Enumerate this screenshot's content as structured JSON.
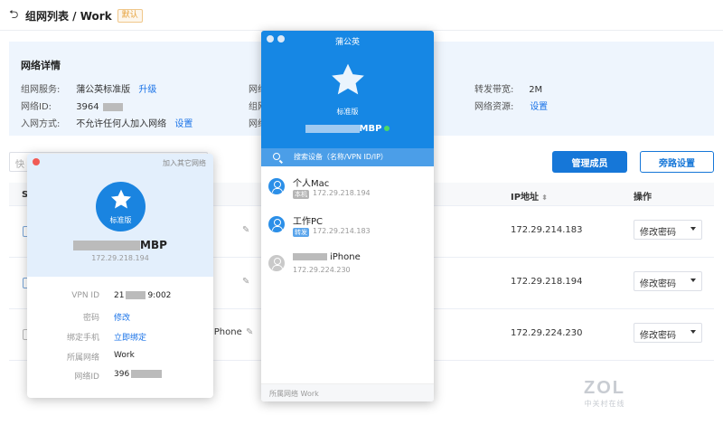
{
  "header": {
    "title": "组网列表 / Work",
    "badge": "默认"
  },
  "details": {
    "title": "网络详情",
    "service_label": "组网服务:",
    "service_value": "蒲公英标准版",
    "upgrade_link": "升级",
    "netid_label": "网络ID:",
    "netid_value": "3964",
    "join_label": "入网方式:",
    "join_value": "不允许任何人加入网络",
    "join_link": "设置",
    "col2_label_1": "网络",
    "col2_label_2": "组网",
    "col2_label_3": "网络",
    "bandwidth_label": "转发带宽:",
    "bandwidth_value": "2M",
    "resource_label": "网络资源:",
    "resource_link": "设置"
  },
  "toolbar": {
    "search_placeholder": "快",
    "manage_label": "管理成员",
    "bypass_label": "旁路设置"
  },
  "table": {
    "first_col_letter": "S",
    "headers": {
      "ip": "IP地址",
      "action": "操作"
    },
    "rows": [
      {
        "ip": "172.29.214.183",
        "action": "修改密码"
      },
      {
        "ip": "172.29.218.194",
        "action": "修改密码"
      },
      {
        "ip": "172.29.224.230",
        "action": "修改密码",
        "name_tail": "iPhone"
      }
    ]
  },
  "card": {
    "join_other": "加入其它网络",
    "edition": "标准版",
    "device_name": "MBP",
    "device_ip": "172.29.218.194",
    "rows": [
      {
        "label": "VPN ID",
        "value_prefix": "21",
        "value_suffix": "9:002"
      },
      {
        "label": "密码",
        "value": "修改"
      },
      {
        "label": "绑定手机",
        "value": "立即绑定"
      },
      {
        "label": "所属网络",
        "value": "Work"
      },
      {
        "label": "网络ID",
        "value_prefix": "396"
      }
    ]
  },
  "app": {
    "title": "蒲公英",
    "edition": "标准版",
    "device_name": "MBP",
    "search_placeholder": "搜索设备（名称/VPN ID/IP）",
    "devices": [
      {
        "name": "个人Mac",
        "tag": "本机",
        "ip": "172.29.218.194",
        "online": true
      },
      {
        "name": "工作PC",
        "tag": "转发",
        "ip": "172.29.214.183",
        "online": true
      },
      {
        "name": "iPhone",
        "tag": "",
        "ip": "172.29.224.230",
        "online": false
      }
    ],
    "footer": "所属网络 Work"
  },
  "watermark": {
    "big": "ZOL",
    "small": "中关村在线"
  },
  "colors": {
    "accent": "#1677d8",
    "app_blue": "#1687e4",
    "panel_bg": "#eef5fd"
  }
}
